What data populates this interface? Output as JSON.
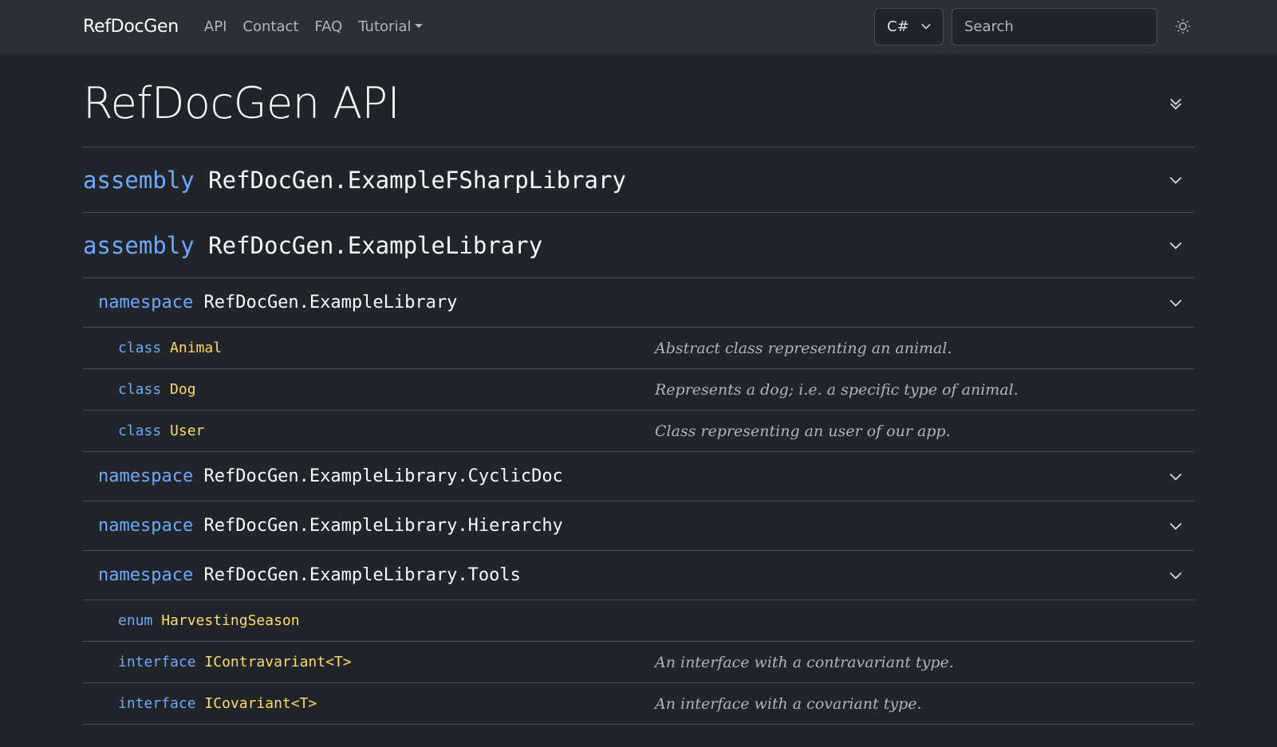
{
  "navbar": {
    "brand": "RefDocGen",
    "links": [
      "API",
      "Contact",
      "FAQ",
      "Tutorial"
    ],
    "language": "C#",
    "search_placeholder": "Search"
  },
  "page": {
    "title": "RefDocGen API"
  },
  "assemblies": [
    {
      "keyword": "assembly",
      "name": "RefDocGen.ExampleFSharpLibrary"
    },
    {
      "keyword": "assembly",
      "name": "RefDocGen.ExampleLibrary"
    }
  ],
  "namespaces": [
    {
      "keyword": "namespace",
      "name": "RefDocGen.ExampleLibrary",
      "types": [
        {
          "kind": "class",
          "name": "Animal",
          "desc": "Abstract class representing an animal."
        },
        {
          "kind": "class",
          "name": "Dog",
          "desc": "Represents a dog; i.e. a specific type of animal."
        },
        {
          "kind": "class",
          "name": "User",
          "desc": "Class representing an user of our app."
        }
      ]
    },
    {
      "keyword": "namespace",
      "name": "RefDocGen.ExampleLibrary.CyclicDoc"
    },
    {
      "keyword": "namespace",
      "name": "RefDocGen.ExampleLibrary.Hierarchy"
    },
    {
      "keyword": "namespace",
      "name": "RefDocGen.ExampleLibrary.Tools",
      "types": [
        {
          "kind": "enum",
          "name": "HarvestingSeason",
          "desc": ""
        },
        {
          "kind": "interface",
          "name": "IContravariant<T>",
          "desc": "An interface with a contravariant type."
        },
        {
          "kind": "interface",
          "name": "ICovariant<T>",
          "desc": "An interface with a covariant type."
        }
      ]
    }
  ],
  "colors": {
    "keyword": "#6ea8fe",
    "type_name": "#ffda6a",
    "background": "#212529",
    "navbar": "#2b3035"
  }
}
